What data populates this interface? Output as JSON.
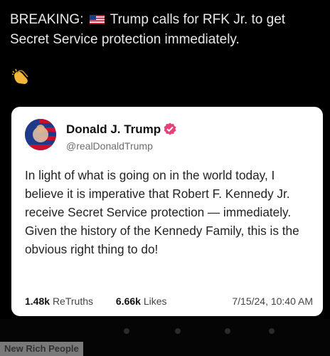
{
  "headline": {
    "prefix": "BREAKING:",
    "flag_icon": "us-flag-icon",
    "line1": "Trump calls for RFK Jr. to get",
    "line2": "Secret Service protection immediately.",
    "reaction_icon": "clapping-hands-icon"
  },
  "post": {
    "author_name": "Donald J. Trump",
    "handle": "@realDonaldTrump",
    "verified_color": "#e8407a",
    "text": "In light of what is going on in the world today, I believe it is imperative that Robert F. Kennedy Jr. receive Secret Service protection — immediately. Given the history of the Kennedy Family, this is the obvious right thing to do!",
    "retruths_count": "1.48k",
    "retruths_label": "ReTruths",
    "likes_count": "6.66k",
    "likes_label": "Likes",
    "timestamp": "7/15/24, 10:40 AM"
  },
  "watermark": "New Rich People"
}
